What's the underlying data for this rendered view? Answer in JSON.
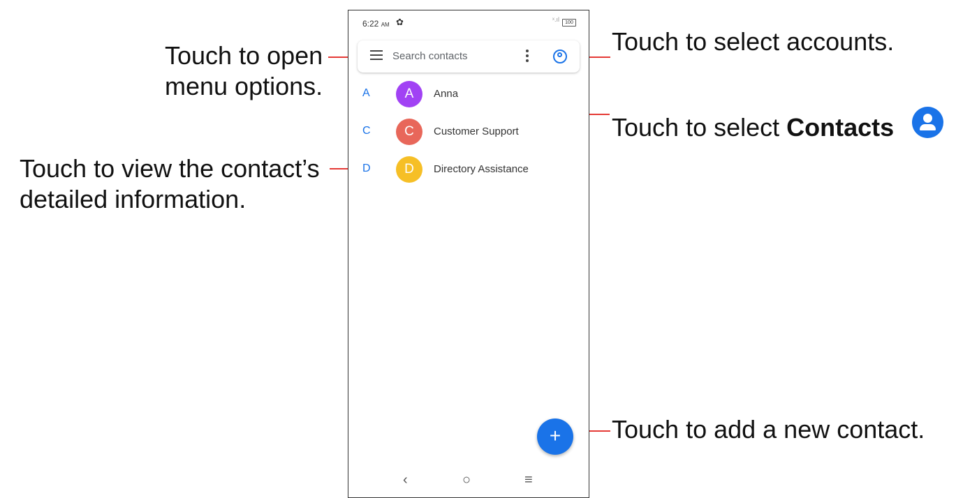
{
  "callouts": {
    "menu_line1": "Touch to open",
    "menu_line2": "menu options.",
    "accounts": "Touch to select accounts.",
    "contacts_prefix": "Touch to select ",
    "contacts_bold": "Contacts",
    "detail_line1": "Touch to view the contact’s",
    "detail_line2": "detailed information.",
    "add": "Touch to add a new contact."
  },
  "status_bar": {
    "time": "6:22",
    "ampm": "AM",
    "battery": "100"
  },
  "search": {
    "placeholder": "Search contacts"
  },
  "contacts": [
    {
      "section": "A",
      "initial": "A",
      "name": "Anna",
      "color": "#a142f4"
    },
    {
      "section": "C",
      "initial": "C",
      "name": "Customer Support",
      "color": "#e8675a"
    },
    {
      "section": "D",
      "initial": "D",
      "name": "Directory Assistance",
      "color": "#f6bf26"
    }
  ],
  "fab": {
    "label": "+"
  },
  "nav": {
    "back": "‹",
    "home": "○",
    "recents": "≡"
  },
  "colors": {
    "accent": "#1a73e8",
    "callout_line": "#e53935"
  }
}
